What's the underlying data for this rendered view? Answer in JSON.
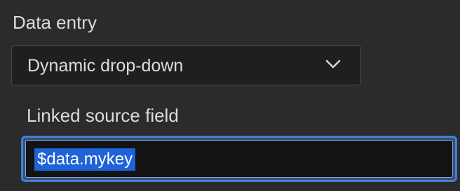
{
  "data_entry": {
    "label": "Data entry",
    "select": {
      "value": "Dynamic drop-down",
      "icon": "chevron-down-icon"
    }
  },
  "linked_source": {
    "label": "Linked source field",
    "input": {
      "value": "$data.mykey",
      "selected": true
    }
  },
  "colors": {
    "background": "#2b2b2b",
    "focus_ring": "#3f7fd8",
    "selection": "#1e63d8"
  }
}
